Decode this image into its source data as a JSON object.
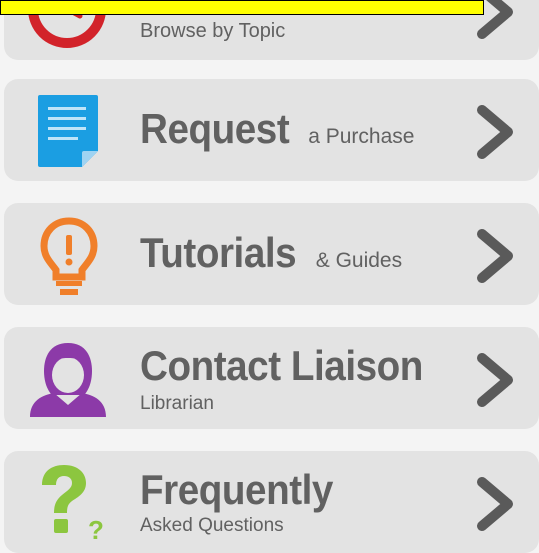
{
  "menu": {
    "items": [
      {
        "id": "browse",
        "title": "",
        "subtitle": "Browse by Topic",
        "icon": "compass-icon",
        "color": "#d2232a"
      },
      {
        "id": "request",
        "title": "Request",
        "subtitle": "a Purchase",
        "icon": "document-icon",
        "color": "#1b9ee2"
      },
      {
        "id": "tutorials",
        "title": "Tutorials",
        "subtitle": "& Guides",
        "icon": "lightbulb-icon",
        "color": "#f07f2a"
      },
      {
        "id": "contact",
        "title": "Contact Liaison",
        "subtitle": "Librarian",
        "icon": "person-icon",
        "color": "#8c3aa8"
      },
      {
        "id": "faq",
        "title": "Frequently",
        "subtitle": "Asked Questions",
        "icon": "question-icon",
        "color": "#8cc63f"
      }
    ]
  },
  "chevron_color": "#5a5a5a",
  "highlight_color": "#ffff00"
}
